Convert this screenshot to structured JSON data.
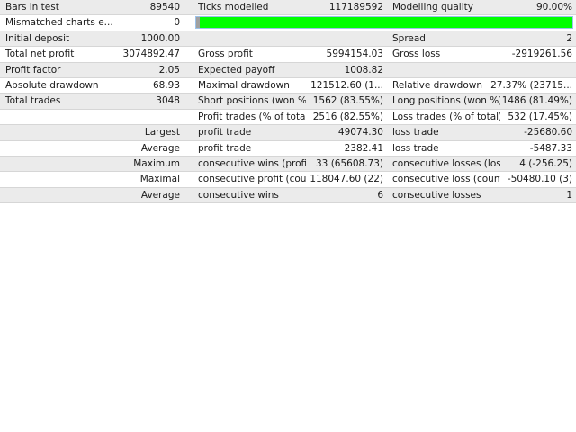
{
  "rows": [
    {
      "l1": "Bars in test",
      "v1": "89540",
      "l2": "Ticks modelled",
      "v2": "117189592",
      "l3": "Modelling quality",
      "v3": "90.00%"
    },
    {
      "l1": "Mismatched charts e...",
      "v1": "0"
    },
    {
      "l1": "Initial deposit",
      "v1": "1000.00",
      "l2": "",
      "v2": "",
      "l3": "Spread",
      "v3": "2"
    },
    {
      "l1": "Total net profit",
      "v1": "3074892.47",
      "l2": "Gross profit",
      "v2": "5994154.03",
      "l3": "Gross loss",
      "v3": "-2919261.56"
    },
    {
      "l1": "Profit factor",
      "v1": "2.05",
      "l2": "Expected payoff",
      "v2": "1008.82",
      "l3": "",
      "v3": ""
    },
    {
      "l1": "Absolute drawdown",
      "v1": "68.93",
      "l2": "Maximal drawdown",
      "v2": "121512.60 (1...",
      "l3": "Relative drawdown",
      "v3": "27.37% (23715..."
    },
    {
      "l1": "Total trades",
      "v1": "3048",
      "l2": "Short positions (won %)",
      "v2": "1562 (83.55%)",
      "l3": "Long positions (won %)",
      "v3": "1486 (81.49%)"
    },
    {
      "l1": "",
      "v1": "",
      "l2": "Profit trades (% of total)",
      "v2": "2516 (82.55%)",
      "l3": "Loss trades (% of total)",
      "v3": "532 (17.45%)"
    },
    {
      "l1": "",
      "v1": "Largest",
      "l2": "profit trade",
      "v2": "49074.30",
      "l3": "loss trade",
      "v3": "-25680.60"
    },
    {
      "l1": "",
      "v1": "Average",
      "l2": "profit trade",
      "v2": "2382.41",
      "l3": "loss trade",
      "v3": "-5487.33"
    },
    {
      "l1": "",
      "v1": "Maximum",
      "l2": "consecutive wins (profit i...",
      "v2": "33 (65608.73)",
      "l3": "consecutive losses (loss i...",
      "v3": "4 (-256.25)"
    },
    {
      "l1": "",
      "v1": "Maximal",
      "l2": "consecutive profit (count...",
      "v2": "118047.60 (22)",
      "l3": "consecutive loss (count o...",
      "v3": "-50480.10 (3)"
    },
    {
      "l1": "",
      "v1": "Average",
      "l2": "consecutive wins",
      "v2": "6",
      "l3": "consecutive losses",
      "v3": "1"
    }
  ],
  "quality_bar": {
    "fill_fraction": 0.99,
    "color": "#00ff00"
  }
}
